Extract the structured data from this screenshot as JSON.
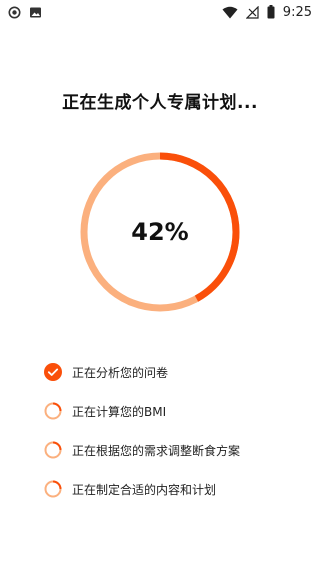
{
  "status_bar": {
    "time": "9:25",
    "left_icons": [
      "record-icon",
      "image-icon"
    ],
    "right_icons": [
      "wifi-icon",
      "signal-icon",
      "battery-icon"
    ]
  },
  "title": "正在生成个人专属计划...",
  "progress": {
    "value": 42,
    "label": "42%",
    "accent_color": "#fa4f0a",
    "track_color": "#fbb07e"
  },
  "steps": [
    {
      "label": "正在分析您的问卷",
      "state": "done"
    },
    {
      "label": "正在计算您的BMI",
      "state": "loading"
    },
    {
      "label": "正在根据您的需求调整断食方案",
      "state": "loading"
    },
    {
      "label": "正在制定合适的内容和计划",
      "state": "loading"
    }
  ]
}
